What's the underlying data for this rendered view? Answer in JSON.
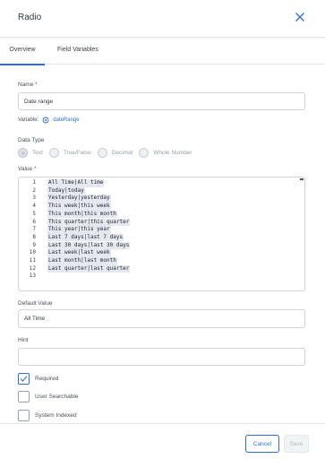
{
  "header": {
    "title": "Radio"
  },
  "tabs": [
    {
      "label": "Overview",
      "active": true
    },
    {
      "label": "Field Variables",
      "active": false
    }
  ],
  "name_field": {
    "label": "Name",
    "required_mark": "*",
    "value": "Date range"
  },
  "variable": {
    "label": "Variable:",
    "value": "dateRange"
  },
  "data_type": {
    "label": "Data Type",
    "options": [
      "Text",
      "True/False",
      "Decimal",
      "Whole Number"
    ],
    "selected": "Text"
  },
  "value_field": {
    "label": "Value",
    "required_mark": "*",
    "lines": [
      {
        "n": "1",
        "text": "All Time|All time"
      },
      {
        "n": "2",
        "text": "Today|today"
      },
      {
        "n": "3",
        "text": "Yesterday|yesterday"
      },
      {
        "n": "4",
        "text": "This week|this week"
      },
      {
        "n": "5",
        "text": "This month|this month"
      },
      {
        "n": "6",
        "text": "This quarter|this quarter"
      },
      {
        "n": "7",
        "text": "This year|this year"
      },
      {
        "n": "8",
        "text": "Last 7 days|last 7 days"
      },
      {
        "n": "9",
        "text": "Last 30 days|last 30 days"
      },
      {
        "n": "10",
        "text": "Last week|last week"
      },
      {
        "n": "11",
        "text": "Last month|last month"
      },
      {
        "n": "12",
        "text": "Last quarter|last quarter"
      },
      {
        "n": "13",
        "text": ""
      }
    ]
  },
  "default_value": {
    "label": "Default Value",
    "value": "All Time"
  },
  "hint": {
    "label": "Hint",
    "value": ""
  },
  "checkboxes": [
    {
      "label": "Required",
      "checked": true
    },
    {
      "label": "User Searchable",
      "checked": false
    },
    {
      "label": "System Indexed",
      "checked": false
    }
  ],
  "footer": {
    "cancel_label": "Cancel",
    "save_label": "Save"
  },
  "colors": {
    "accent": "#2d6cdf",
    "required": "#d9363e"
  }
}
